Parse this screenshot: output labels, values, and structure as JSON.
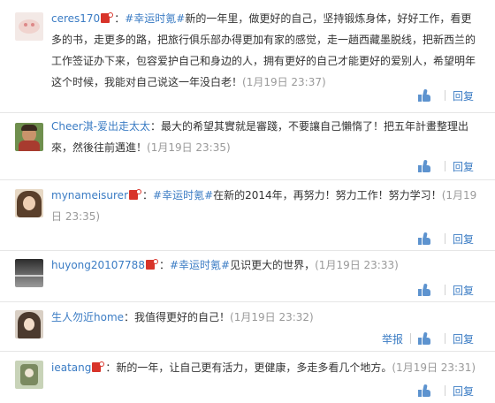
{
  "comments": [
    {
      "username": "ceres170",
      "hashtag": "#幸运时氪#",
      "text": "新的一年里，做更好的自己，坚持锻炼身体，好好工作，看更多的书，走更多的路，把旅行俱乐部办得更加有家的感觉，走一趟西藏墨脱线，把新西兰的工作签证办下来，包容爱护自己和身边的人，拥有更好的自己才能更好的爱别人，希望明年这个时候，我能对自己说这一年没白老！",
      "time": "(1月19日 23:37)",
      "reply": "回复"
    },
    {
      "username": "Cheer淇-爱出走太太",
      "hashtag": "",
      "text": "：最大的希望其實就是審踐，不要讓自己懶惰了！把五年計畫整理出來，然後往前邁進！",
      "time": "(1月19日 23:35)",
      "reply": "回复"
    },
    {
      "username": "mynameisurer",
      "hashtag": "#幸运时氪#",
      "text": "在新的2014年，再努力！努力工作！努力学习！",
      "time": "(1月19日 23:35)",
      "reply": "回复"
    },
    {
      "username": "huyong20107788",
      "hashtag": "#幸运时氪#",
      "text": "见识更大的世界，",
      "time": "(1月19日 23:33)",
      "reply": "回复"
    },
    {
      "username": "生人勿近home",
      "hashtag": "",
      "text": "：我值得更好的自己！",
      "time": "(1月19日 23:32)",
      "reply": "回复",
      "report": "举报"
    },
    {
      "username": "ieatang",
      "hashtag": "",
      "text": "：新的一年，让自己更有活力，更健康，多走多看几个地方。",
      "time": "(1月19日 23:31)",
      "reply": "回复"
    }
  ],
  "colors": {
    "link": "#3b7cc4",
    "time": "#999999",
    "badge": "#d8342a",
    "like": "#5d93cf"
  },
  "icons": {
    "like": "thumbs-up-icon",
    "badge": "vip-badge-icon"
  }
}
